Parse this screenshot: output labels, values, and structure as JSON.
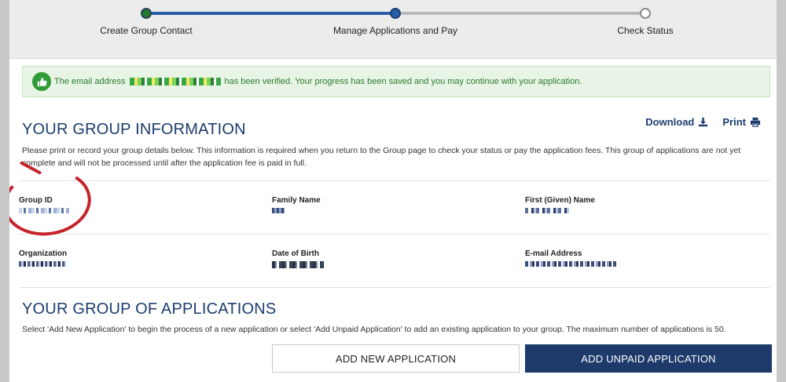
{
  "progress": {
    "steps": [
      {
        "label": "Create Group Contact",
        "state": "done"
      },
      {
        "label": "Manage Applications and Pay",
        "state": "current"
      },
      {
        "label": "Check Status",
        "state": "todo"
      }
    ]
  },
  "alert": {
    "prefix": "The email address",
    "suffix": "has been verified. Your progress has been saved and you may continue with your application.",
    "icon": "thumbs-up-icon",
    "color": "#2b7a2f"
  },
  "group_info": {
    "title": "YOUR GROUP INFORMATION",
    "download_label": "Download",
    "print_label": "Print",
    "description": "Please print or record your group details below. This information is required when you return to the Group page to check your status or pay the application fees. This group of applications are not yet complete and will not be processed until after the application fee is paid in full.",
    "fields": {
      "group_id": "Group ID",
      "family_name": "Family Name",
      "first_name": "First (Given) Name",
      "organization": "Organization",
      "date_of_birth": "Date of Birth",
      "email": "E-mail Address"
    }
  },
  "applications": {
    "title": "YOUR GROUP OF APPLICATIONS",
    "description": "Select 'Add New Application' to begin the process of a new application or select 'Add Unpaid Application' to add an existing application to your group. The maximum number of applications is 50.",
    "add_new_label": "ADD NEW APPLICATION",
    "add_unpaid_label": "ADD UNPAID APPLICATION"
  },
  "colors": {
    "accent": "#1d3a6a",
    "success": "#2f9a36",
    "highlight": "#c6232b"
  }
}
